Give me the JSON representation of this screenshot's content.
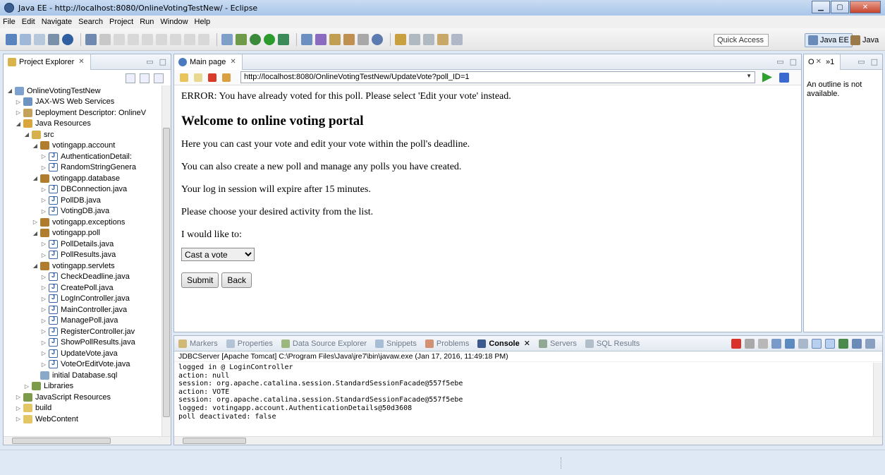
{
  "window": {
    "title": "Java EE - http://localhost:8080/OnlineVotingTestNew/ - Eclipse"
  },
  "menu": [
    "File",
    "Edit",
    "Navigate",
    "Search",
    "Project",
    "Run",
    "Window",
    "Help"
  ],
  "toolbar": {
    "quick_access_placeholder": "Quick Access",
    "perspectives": [
      "Java EE",
      "Java"
    ]
  },
  "explorer": {
    "tab_label": "Project Explorer",
    "tree": [
      {
        "label": "OnlineVotingTestNew",
        "depth": 0,
        "expander": "open",
        "icon": "project"
      },
      {
        "label": "JAX-WS Web Services",
        "depth": 1,
        "expander": "closed",
        "icon": "ws"
      },
      {
        "label": "Deployment Descriptor: OnlineV",
        "depth": 1,
        "expander": "closed",
        "icon": "dd"
      },
      {
        "label": "Java Resources",
        "depth": 1,
        "expander": "open",
        "icon": "jres"
      },
      {
        "label": "src",
        "depth": 2,
        "expander": "open",
        "icon": "src"
      },
      {
        "label": "votingapp.account",
        "depth": 3,
        "expander": "open",
        "icon": "pkg"
      },
      {
        "label": "AuthenticationDetail:",
        "depth": 4,
        "expander": "closed",
        "icon": "java"
      },
      {
        "label": "RandomStringGenera",
        "depth": 4,
        "expander": "closed",
        "icon": "java"
      },
      {
        "label": "votingapp.database",
        "depth": 3,
        "expander": "open",
        "icon": "pkg"
      },
      {
        "label": "DBConnection.java",
        "depth": 4,
        "expander": "closed",
        "icon": "java"
      },
      {
        "label": "PollDB.java",
        "depth": 4,
        "expander": "closed",
        "icon": "java"
      },
      {
        "label": "VotingDB.java",
        "depth": 4,
        "expander": "closed",
        "icon": "java"
      },
      {
        "label": "votingapp.exceptions",
        "depth": 3,
        "expander": "closed",
        "icon": "pkg"
      },
      {
        "label": "votingapp.poll",
        "depth": 3,
        "expander": "open",
        "icon": "pkg"
      },
      {
        "label": "PollDetails.java",
        "depth": 4,
        "expander": "closed",
        "icon": "java"
      },
      {
        "label": "PollResults.java",
        "depth": 4,
        "expander": "closed",
        "icon": "java"
      },
      {
        "label": "votingapp.servlets",
        "depth": 3,
        "expander": "open",
        "icon": "pkg"
      },
      {
        "label": "CheckDeadline.java",
        "depth": 4,
        "expander": "closed",
        "icon": "java"
      },
      {
        "label": "CreatePoll.java",
        "depth": 4,
        "expander": "closed",
        "icon": "java"
      },
      {
        "label": "LogInController.java",
        "depth": 4,
        "expander": "closed",
        "icon": "java"
      },
      {
        "label": "MainController.java",
        "depth": 4,
        "expander": "closed",
        "icon": "java"
      },
      {
        "label": "ManagePoll.java",
        "depth": 4,
        "expander": "closed",
        "icon": "java"
      },
      {
        "label": "RegisterController.jav",
        "depth": 4,
        "expander": "closed",
        "icon": "java"
      },
      {
        "label": "ShowPollResults.java",
        "depth": 4,
        "expander": "closed",
        "icon": "java"
      },
      {
        "label": "UpdateVote.java",
        "depth": 4,
        "expander": "closed",
        "icon": "java"
      },
      {
        "label": "VoteOrEditVote.java",
        "depth": 4,
        "expander": "closed",
        "icon": "java"
      },
      {
        "label": "initial Database.sql",
        "depth": 3,
        "expander": "none",
        "icon": "sql"
      },
      {
        "label": "Libraries",
        "depth": 2,
        "expander": "closed",
        "icon": "lib"
      },
      {
        "label": "JavaScript Resources",
        "depth": 1,
        "expander": "closed",
        "icon": "lib"
      },
      {
        "label": "build",
        "depth": 1,
        "expander": "closed",
        "icon": "folder"
      },
      {
        "label": "WebContent",
        "depth": 1,
        "expander": "closed",
        "icon": "folder"
      }
    ]
  },
  "browser": {
    "tab_label": "Main page",
    "url": "http://localhost:8080/OnlineVotingTestNew/UpdateVote?poll_ID=1",
    "error": "ERROR: You have already voted for this poll. Please select 'Edit your vote' instead.",
    "heading": "Welcome to online voting portal",
    "paragraphs": [
      "Here you can cast your vote and edit your vote within the poll's deadline.",
      "You can also create a new poll and manage any polls you have created.",
      "Your log in session will expire after 15 minutes.",
      "Please choose your desired activity from the list.",
      "I would like to:"
    ],
    "select_value": "Cast a vote",
    "submit_label": "Submit",
    "back_label": "Back"
  },
  "outline": {
    "tab_label": "O",
    "tab_extra": "»1",
    "message": "An outline is not available."
  },
  "console": {
    "tabs": [
      "Markers",
      "Properties",
      "Data Source Explorer",
      "Snippets",
      "Problems",
      "Console",
      "Servers",
      "SQL Results"
    ],
    "active_tab": "Console",
    "header": "JDBCServer [Apache Tomcat] C:\\Program Files\\Java\\jre7\\bin\\javaw.exe (Jan 17, 2016, 11:49:18 PM)",
    "lines": [
      "logged in @ LoginController",
      "action: null",
      "session: org.apache.catalina.session.StandardSessionFacade@557f5ebe",
      "action: VOTE",
      "session: org.apache.catalina.session.StandardSessionFacade@557f5ebe",
      "logged: votingapp.account.AuthenticationDetails@50d3608",
      "poll deactivated: false"
    ]
  }
}
